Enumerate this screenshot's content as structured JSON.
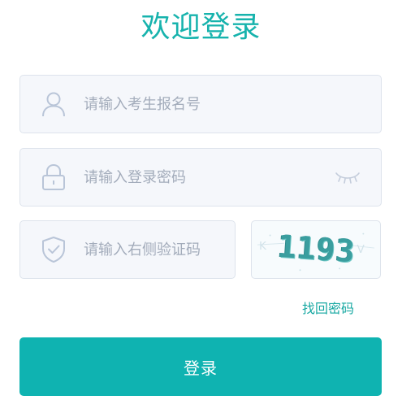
{
  "title": "欢迎登录",
  "fields": {
    "candidate_id": {
      "value": "",
      "placeholder": "请输入考生报名号",
      "icon": "user-icon"
    },
    "password": {
      "value": "",
      "placeholder": "请输入登录密码",
      "icon": "lock-icon",
      "toggle_icon": "eye-closed-icon"
    },
    "captcha": {
      "value": "",
      "placeholder": "请输入右侧验证码",
      "icon": "shield-check-icon"
    }
  },
  "captcha_image": {
    "text": "1193"
  },
  "forgot_password": "找回密码",
  "login_button": "登录",
  "colors": {
    "accent": "#0fb3b1",
    "title": "#17b3ad",
    "link": "#17a8a2",
    "field_bg": "#f5f7fb",
    "field_border": "#dde3ec",
    "icon": "#b9c5d8",
    "placeholder": "#a3acbb"
  }
}
